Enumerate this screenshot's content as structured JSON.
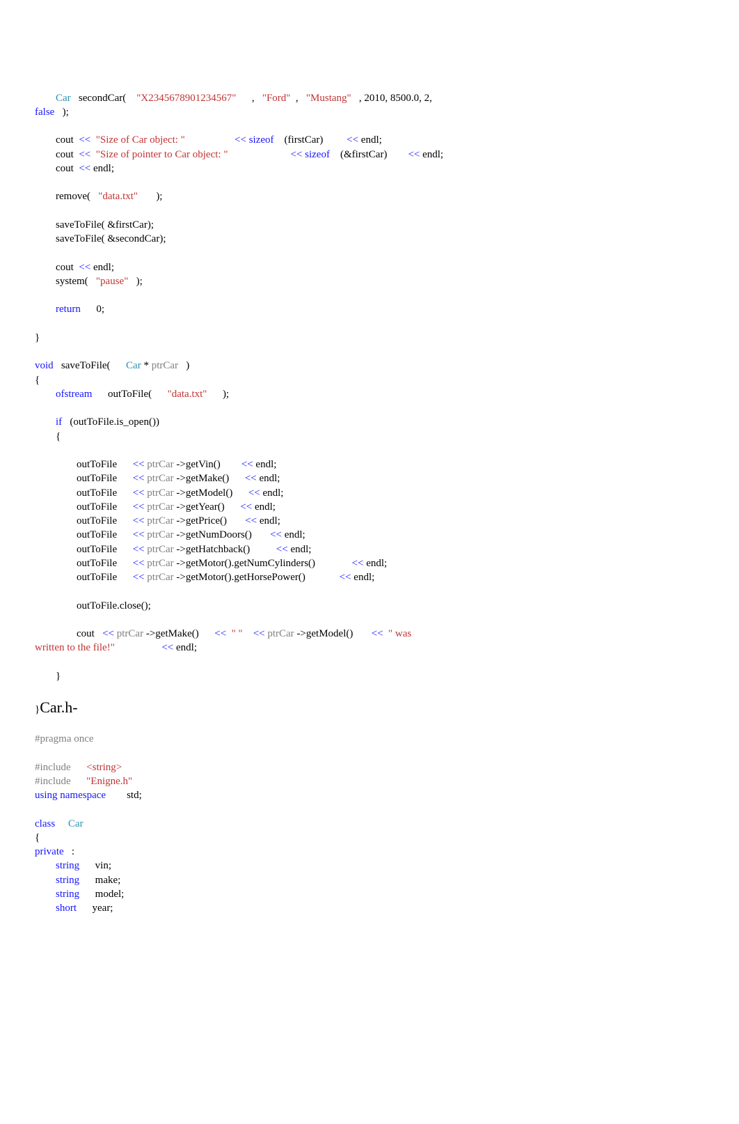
{
  "main_block": {
    "secondCar": {
      "type": "Car",
      "var": "secondCar(",
      "vin": "\"X2345678901234567\"",
      "make": "\"Ford\"",
      "model": "\"Mustang\"",
      "tail": ", 2010, 8500.0, 2, ",
      "false_kw": "false",
      "close": ");"
    },
    "cout1_pre": "cout  ",
    "cout1_str": "\"Size of Car object: \"",
    "cout1_mid": "  ",
    "cout1_sizeof": "sizeof",
    "cout1_after": " (firstCar)         ",
    "cout1_end": " endl;",
    "cout2_pre": "cout  ",
    "cout2_str": "\"Size of pointer to Car object: \"",
    "cout2_mid": "                        ",
    "cout2_sizeof": "sizeof",
    "cout2_after": " (&firstCar)        ",
    "cout2_end": " endl;",
    "cout3_pre": "cout  ",
    "cout3_end": " endl;",
    "remove_pre": "remove( ",
    "remove_arg": "\"data.txt\"",
    "remove_post": "       );",
    "save1": "saveToFile( &firstCar);",
    "save2": "saveToFile( &secondCar);",
    "cout4_pre": "cout  ",
    "cout4_end": " endl;",
    "system_pre": "system( ",
    "system_arg": "\"pause\"",
    "system_post": "   );",
    "return_kw": "return",
    "return_val": "      0;"
  },
  "func": {
    "void_kw": "void",
    "name_pre": "   saveToFile(      ",
    "carType": "Car",
    "star": " * ",
    "param": "ptrCar",
    "param_close": "   )",
    "ofstream_kw": "ofstream",
    "ofstream_mid": "      outToFile(      ",
    "ofstream_arg": "\"data.txt\"",
    "ofstream_post": "      );",
    "if_kw": "if",
    "if_cond": "   (outToFile.is_open())",
    "lines": [
      {
        "pre": "outToFile      ",
        "op": "<<",
        "p": " ptrCar",
        "call": " ->getVin()        ",
        "op2": "<<",
        "end": " endl;"
      },
      {
        "pre": "outToFile      ",
        "op": "<<",
        "p": " ptrCar",
        "call": " ->getMake()      ",
        "op2": "<<",
        "end": " endl;"
      },
      {
        "pre": "outToFile      ",
        "op": "<<",
        "p": " ptrCar",
        "call": " ->getModel()      ",
        "op2": "<<",
        "end": " endl;"
      },
      {
        "pre": "outToFile      ",
        "op": "<<",
        "p": " ptrCar",
        "call": " ->getYear()      ",
        "op2": "<<",
        "end": " endl;"
      },
      {
        "pre": "outToFile      ",
        "op": "<<",
        "p": " ptrCar",
        "call": " ->getPrice()       ",
        "op2": "<<",
        "end": " endl;"
      },
      {
        "pre": "outToFile      ",
        "op": "<<",
        "p": " ptrCar",
        "call": " ->getNumDoors()       ",
        "op2": "<<",
        "end": " endl;"
      },
      {
        "pre": "outToFile      ",
        "op": "<<",
        "p": " ptrCar",
        "call": " ->getHatchback()          ",
        "op2": "<<",
        "end": " endl;"
      },
      {
        "pre": "outToFile      ",
        "op": "<<",
        "p": " ptrCar",
        "call": " ->getMotor().getNumCylinders()              ",
        "op2": "<<",
        "end": " endl;"
      },
      {
        "pre": "outToFile      ",
        "op": "<<",
        "p": " ptrCar",
        "call": " ->getMotor().getHorsePower()             ",
        "op2": "<<",
        "end": " endl;"
      }
    ],
    "close_call": "outToFile.close();",
    "cout_pre": "cout   ",
    "cout_p1": " ptrCar",
    "cout_call1": " ->getMake()      ",
    "cout_strsp": "\" \"",
    "cout_p2": " ptrCar",
    "cout_call2": " ->getModel()       ",
    "cout_strwas": "\" was ",
    "cout_written": "written to the file!\"",
    "cout_end": " endl;"
  },
  "carh": {
    "closebrace": "}",
    "title": "Car.h-",
    "pragma": "#pragma once",
    "inc1_d": "#include",
    "inc1_v": "<string>",
    "inc2_d": "#include",
    "inc2_v": "\"Enigne.h\"",
    "using_kw": "using namespace",
    "using_val": "        std;",
    "class_kw": "class",
    "class_name": "Car",
    "private_kw": "private",
    "private_colon": "   :",
    "m1_t": "string",
    "m1_n": "      vin;",
    "m2_t": "string",
    "m2_n": "      make;",
    "m3_t": "string",
    "m3_n": "      model;",
    "m4_t": "short",
    "m4_n": "      year;"
  }
}
